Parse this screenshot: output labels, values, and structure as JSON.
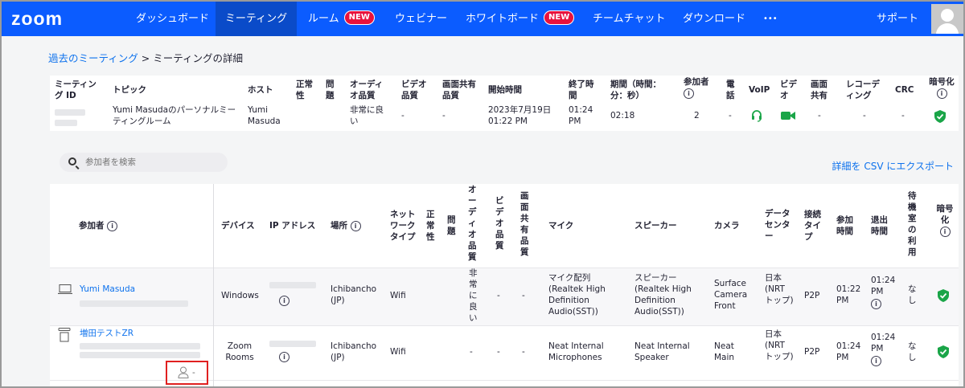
{
  "nav": {
    "logo": "zoom",
    "items": [
      {
        "label": "ダッシュボード"
      },
      {
        "label": "ミーティング"
      },
      {
        "label": "ルーム",
        "badge": "NEW"
      },
      {
        "label": "ウェビナー"
      },
      {
        "label": "ホワイトボード",
        "badge": "NEW"
      },
      {
        "label": "チームチャット"
      },
      {
        "label": "ダウンロード"
      },
      {
        "label": "•••"
      }
    ],
    "support": "サポート"
  },
  "breadcrumb": {
    "parent": "過去のミーティング",
    "separator": " > ",
    "current": "ミーティングの詳細"
  },
  "summary": {
    "headers": {
      "meeting_id": "ミーティング ID",
      "topic": "トピック",
      "host": "ホスト",
      "normal": "正常性",
      "issues": "問題",
      "audio": "オーディオ品質",
      "video": "ビデオ品質",
      "share": "画面共有品質",
      "start": "開始時間",
      "end": "終了時間",
      "duration": "期間（時間：分：秒）",
      "participants": "参加者",
      "phone": "電話",
      "voip": "VoIP",
      "video_icon": "ビデオ",
      "screen_share": "画面共有",
      "recording": "レコーディング",
      "crc": "CRC",
      "encryption": "暗号化"
    },
    "row": {
      "topic": "Yumi Masudaのパーソナルミーティングルーム",
      "host": "Yumi Masuda",
      "audio": "非常に良い",
      "video": "-",
      "share": "-",
      "start": "2023年7月19日 01:22 PM",
      "end": "01:24 PM",
      "duration": "02:18",
      "participants": "2",
      "phone": "-",
      "screen_share": "-",
      "recording": "-",
      "crc": "-"
    }
  },
  "search": {
    "placeholder": "参加者を検索"
  },
  "export_label": "詳細を CSV にエクスポート",
  "participants": {
    "headers": {
      "participant": "参加者",
      "device": "デバイス",
      "ip": "IP アドレス",
      "location": "場所",
      "network": "ネットワークタイプ",
      "normal": "正常性",
      "issues": "問題",
      "audio": "オーディオ品質",
      "video": "ビデオ品質",
      "share": "画面共有品質",
      "mic": "マイク",
      "speaker": "スピーカー",
      "camera": "カメラ",
      "datacenter": "データセンター",
      "connection": "接続タイプ",
      "join": "参加時間",
      "leave": "退出時間",
      "waiting": "待機室の利用",
      "encryption": "暗号化"
    },
    "rows": [
      {
        "name": "Yumi Masuda",
        "device": "Windows",
        "location": "Ichibancho (JP)",
        "network": "Wifi",
        "audio": "非常に良い",
        "video": "-",
        "share": "-",
        "mic": "マイク配列 (Realtek High Definition Audio(SST))",
        "speaker": "スピーカー (Realtek High Definition Audio(SST))",
        "camera": "Surface Camera Front",
        "datacenter": "日本 (NRT トップ)",
        "connection": "P2P",
        "join": "01:22 PM",
        "leave": "01:24 PM",
        "waiting": "なし"
      },
      {
        "name": "増田テストZR",
        "device": "Zoom Rooms",
        "location": "Ichibancho (JP)",
        "network": "Wifi",
        "audio": "-",
        "video": "-",
        "share": "-",
        "mic": "Neat Internal Microphones",
        "speaker": "Neat Internal Speaker",
        "camera": "Neat Main",
        "datacenter": "日本 (NRT トップ)",
        "connection": "P2P",
        "join": "01:24 PM",
        "leave": "01:24 PM",
        "waiting": "なし",
        "sub_count": "-"
      }
    ]
  },
  "colors": {
    "nav": "#0b5cff",
    "link": "#0e72ed",
    "green": "#1aa548",
    "highlight": "#e02020"
  }
}
